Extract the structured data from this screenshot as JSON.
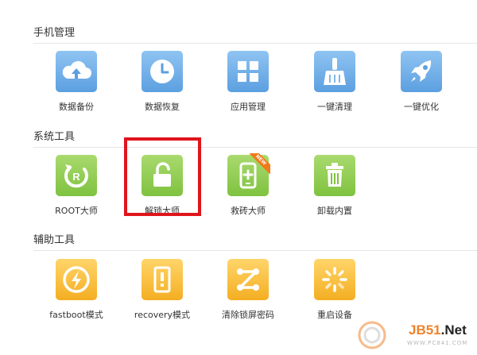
{
  "sections": [
    {
      "title": "手机管理",
      "items": [
        {
          "label": "数据备份",
          "icon": "cloud-upload-icon",
          "color": "blue"
        },
        {
          "label": "数据恢复",
          "icon": "clock-icon",
          "color": "blue"
        },
        {
          "label": "应用管理",
          "icon": "app-grid-icon",
          "color": "blue"
        },
        {
          "label": "一键清理",
          "icon": "broom-icon",
          "color": "blue"
        },
        {
          "label": "一键优化",
          "icon": "rocket-icon",
          "color": "blue"
        }
      ]
    },
    {
      "title": "系统工具",
      "items": [
        {
          "label": "ROOT大师",
          "icon": "root-icon",
          "color": "green"
        },
        {
          "label": "解锁大师",
          "icon": "unlock-icon",
          "color": "green",
          "highlighted": true
        },
        {
          "label": "救砖大师",
          "icon": "phone-repair-icon",
          "color": "green",
          "badge": "NEW"
        },
        {
          "label": "卸载内置",
          "icon": "trash-icon",
          "color": "green"
        }
      ]
    },
    {
      "title": "辅助工具",
      "items": [
        {
          "label": "fastboot模式",
          "icon": "lightning-icon",
          "color": "orange"
        },
        {
          "label": "recovery模式",
          "icon": "recovery-icon",
          "color": "orange"
        },
        {
          "label": "清除锁屏密码",
          "icon": "pattern-lock-icon",
          "color": "orange"
        },
        {
          "label": "重启设备",
          "icon": "restart-spinner-icon",
          "color": "orange"
        }
      ]
    }
  ],
  "colors": {
    "blue": "#6aaae6",
    "green": "#8bcb4e",
    "orange": "#f7b731",
    "highlight": "#e0141b",
    "badge": "#f07a18"
  },
  "watermark": {
    "brand_main": "JB51",
    "brand_suffix": ".Net",
    "url": "WWW.PC841.COM"
  }
}
